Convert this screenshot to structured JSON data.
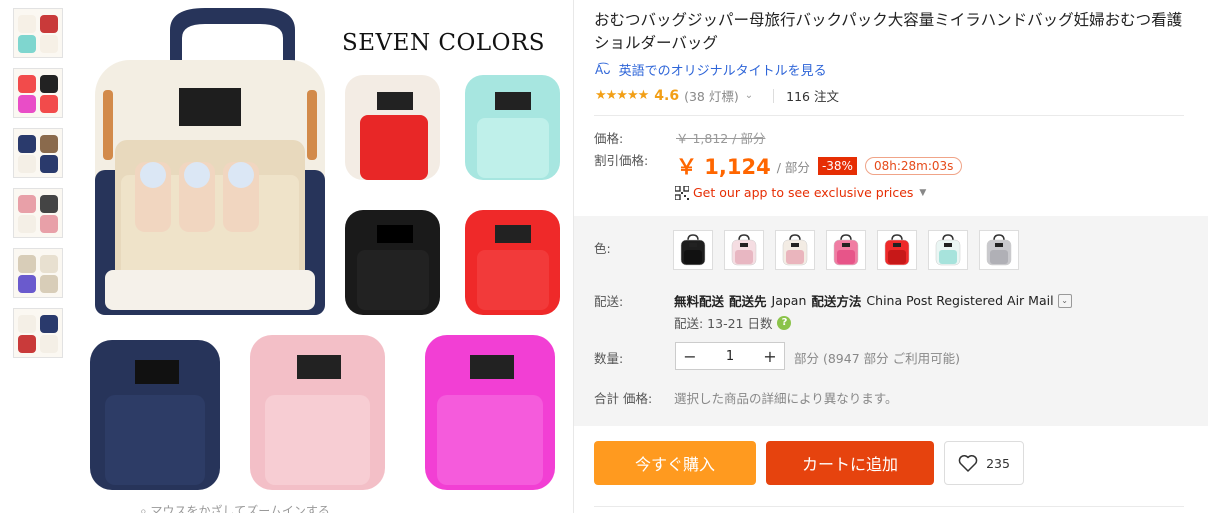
{
  "thumbnails": [
    {
      "name": "thumb-1",
      "colors": [
        "#f6f0e6",
        "#c93a3a",
        "#7fd6cf"
      ]
    },
    {
      "name": "thumb-2",
      "colors": [
        "#f24b4b",
        "#222",
        "#e94dc7"
      ]
    },
    {
      "name": "thumb-3",
      "colors": [
        "#2a3a6c",
        "#8a6a4c",
        "#f4efe6"
      ]
    },
    {
      "name": "thumb-4",
      "colors": [
        "#e8a0a8",
        "#444",
        "#f4efe6"
      ]
    },
    {
      "name": "thumb-5",
      "colors": [
        "#d8cdb8",
        "#e8e0d0",
        "#6a5acd"
      ]
    },
    {
      "name": "thumb-6",
      "colors": [
        "#f4efe6",
        "#2a3a6c",
        "#c93a3a"
      ]
    }
  ],
  "main_image": {
    "caption": "SEVEN COLORS",
    "zoom_hint": "マウスをかざしてズームインする"
  },
  "product": {
    "title": "おむつバッグジッパー母旅行バックパック大容量ミイラハンドバッグ妊婦おむつ看護ショルダーバッグ",
    "translate_link": "英語でのオリジナルタイトルを見る",
    "rating_stars": "★★★★★",
    "rating_value": "4.6",
    "rating_count": "(38 灯標)",
    "orders": "116 注文"
  },
  "price": {
    "label": "価格:",
    "original": "￥ 1,812 / 部分",
    "sale_label": "割引価格:",
    "sale_value": "￥ 1,124",
    "sale_unit": "/ 部分",
    "discount": "-38%",
    "countdown": "08h:28m:03s",
    "app_promo": "Get our app to see exclusive prices"
  },
  "color": {
    "label": "色:",
    "swatches": [
      {
        "name": "black",
        "hex": "#1e1e1e",
        "accent": "#111"
      },
      {
        "name": "light-pink",
        "hex": "#f5dde2",
        "accent": "#e8b7c2"
      },
      {
        "name": "cream-pink",
        "hex": "#f3ece4",
        "accent": "#eab5bd"
      },
      {
        "name": "pink",
        "hex": "#f07da3",
        "accent": "#e75589"
      },
      {
        "name": "red",
        "hex": "#ee2a2a",
        "accent": "#c71818"
      },
      {
        "name": "mint",
        "hex": "#eaf6f4",
        "accent": "#a7e3dc"
      },
      {
        "name": "gray",
        "hex": "#c9c9cd",
        "accent": "#b0b0b6"
      }
    ]
  },
  "shipping": {
    "label": "配送:",
    "free": "無料配送",
    "to_label": "配送先",
    "to_value": "Japan",
    "method_label": "配送方法",
    "method_value": "China Post Registered Air Mail",
    "days": "配送: 13-21 日数"
  },
  "quantity": {
    "label": "数量:",
    "value": "1",
    "stock": "部分 (8947 部分 ご利用可能)"
  },
  "total": {
    "label": "合計 価格:",
    "note": "選択した商品の詳細により異なります。"
  },
  "actions": {
    "buy_now": "今すぐ購入",
    "add_to_cart": "カートに追加",
    "wishlist_count": "235"
  }
}
